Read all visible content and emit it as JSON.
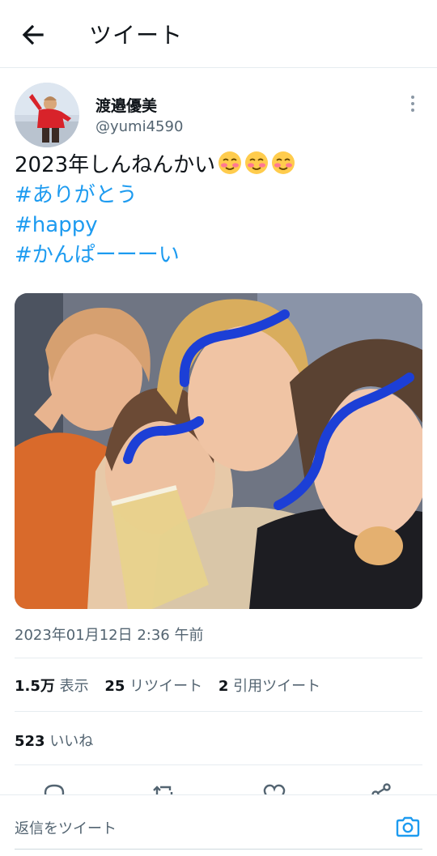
{
  "header": {
    "title": "ツイート",
    "back_icon": "arrow-left-icon"
  },
  "author": {
    "name": "渡邉優美",
    "handle": "@yumi4590"
  },
  "tweet": {
    "text_main": "2023年しんねんかい",
    "emoji": [
      "smiling-blushing-face",
      "smiling-blushing-face",
      "smiling-blushing-face"
    ],
    "hashtags": [
      "#ありがとう",
      "#happy",
      "#かんぱーーーい"
    ]
  },
  "meta": {
    "timestamp": "2023年01月12日 2:36 午前"
  },
  "stats": {
    "views_count": "1.5万",
    "views_label": "表示",
    "retweets_count": "25",
    "retweets_label": "リツイート",
    "quotes_count": "2",
    "quotes_label": "引用ツイート"
  },
  "likes": {
    "count": "523",
    "label": "いいね"
  },
  "reply": {
    "placeholder": "返信をツイート"
  },
  "colors": {
    "accent": "#1d9bf0",
    "text": "#0f1419",
    "muted": "#536471",
    "border": "#e6ecf0"
  }
}
